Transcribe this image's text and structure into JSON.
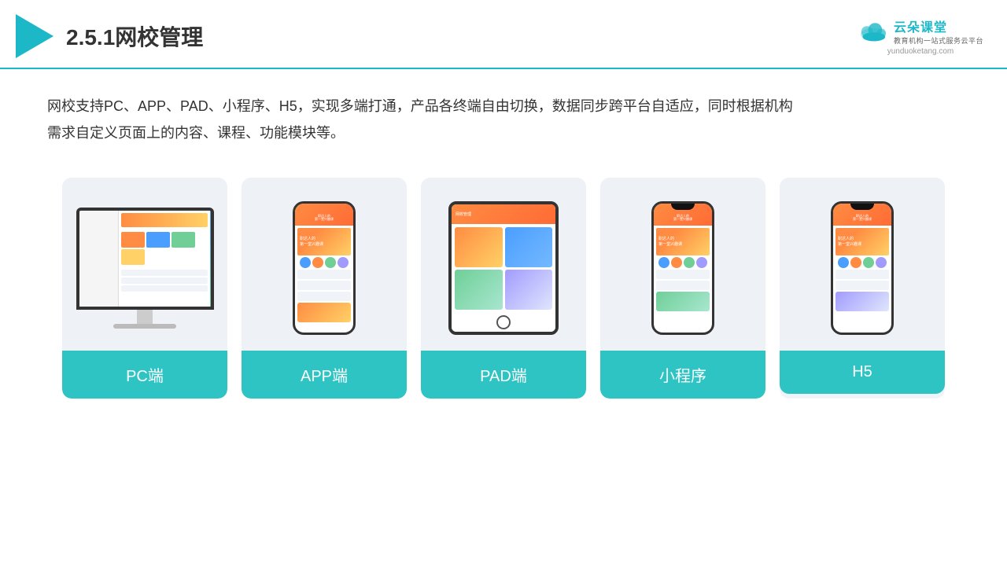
{
  "header": {
    "title": "2.5.1网校管理",
    "brand": {
      "name": "云朵课堂",
      "slogan": "教育机构一站\n式服务云平台",
      "url": "yunduoketang.com"
    }
  },
  "description": {
    "text": "网校支持PC、APP、PAD、小程序、H5，实现多端打通，产品各终端自由切换，数据同步跨平台自适应，同时根据机构需求自定义页面上的内容、课程、功能模块等。"
  },
  "cards": [
    {
      "id": "pc",
      "label": "PC端"
    },
    {
      "id": "app",
      "label": "APP端"
    },
    {
      "id": "pad",
      "label": "PAD端"
    },
    {
      "id": "miniapp",
      "label": "小程序"
    },
    {
      "id": "h5",
      "label": "H5"
    }
  ],
  "colors": {
    "teal": "#2ec4c4",
    "accent": "#1db8c8",
    "bg_card": "#eef2f7"
  }
}
